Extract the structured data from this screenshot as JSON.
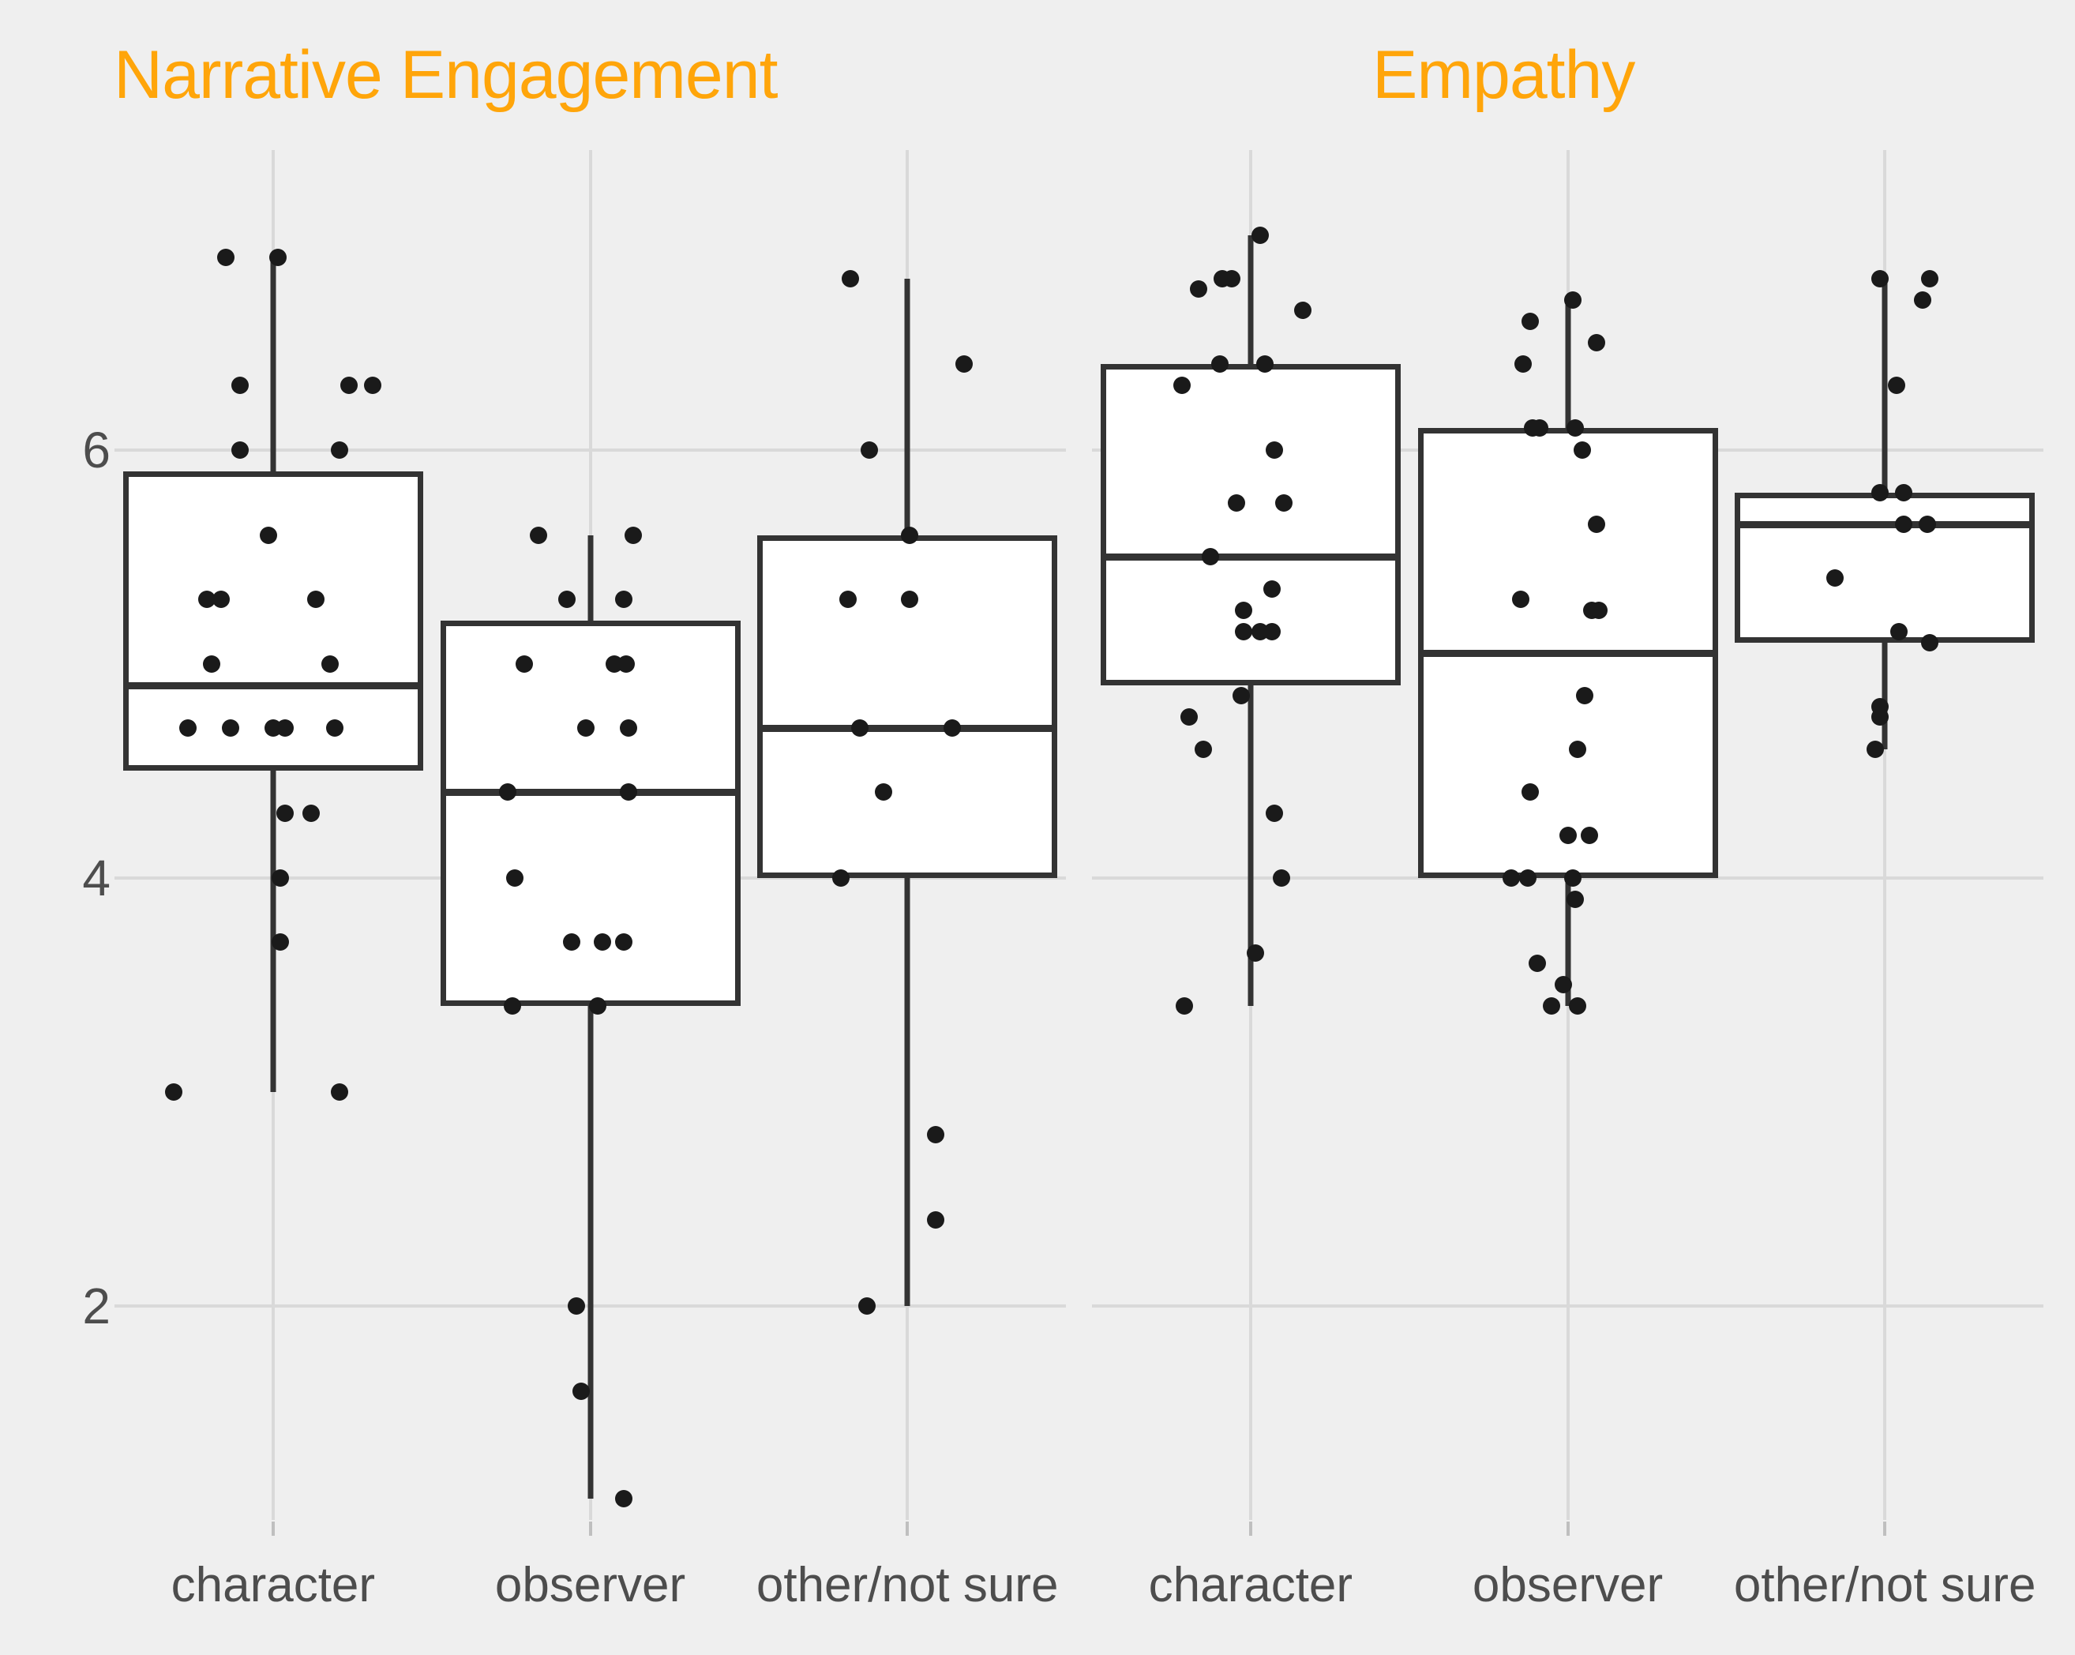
{
  "chart_data": {
    "type": "box",
    "title": "",
    "xlabel": "",
    "ylabel": "",
    "ylim": [
      1.0,
      7.4
    ],
    "yticks": [
      2,
      4,
      6
    ],
    "ytick_labels": [
      "2",
      "4",
      "6"
    ],
    "grid": true,
    "legend": "none",
    "accent_color": "#FFA50A",
    "point_color": "#1A1A1A",
    "box_fill": "#FFFFFF",
    "box_stroke": "#333333",
    "background": "#EFEFEF",
    "grid_color": "#D9D9D9",
    "categories": [
      "character",
      "observer",
      "other/not sure"
    ],
    "panels": [
      {
        "title": "Narrative Engagement",
        "groups": [
          {
            "label": "character",
            "box": {
              "lower_whisker": 3.0,
              "q1": 4.5,
              "median": 4.9,
              "q3": 5.9,
              "upper_whisker": 6.9
            },
            "points": [
              {
                "value": 6.9,
                "jitter": -0.2
              },
              {
                "value": 6.9,
                "jitter": 0.02
              },
              {
                "value": 6.3,
                "jitter": -0.14
              },
              {
                "value": 6.3,
                "jitter": 0.32
              },
              {
                "value": 6.3,
                "jitter": 0.42
              },
              {
                "value": 6.0,
                "jitter": -0.14
              },
              {
                "value": 6.0,
                "jitter": 0.28
              },
              {
                "value": 5.6,
                "jitter": -0.02
              },
              {
                "value": 5.3,
                "jitter": -0.28
              },
              {
                "value": 5.3,
                "jitter": -0.22
              },
              {
                "value": 5.3,
                "jitter": 0.18
              },
              {
                "value": 5.0,
                "jitter": -0.26
              },
              {
                "value": 5.0,
                "jitter": 0.24
              },
              {
                "value": 4.7,
                "jitter": -0.36
              },
              {
                "value": 4.7,
                "jitter": -0.18
              },
              {
                "value": 4.7,
                "jitter": 0.0
              },
              {
                "value": 4.7,
                "jitter": 0.05
              },
              {
                "value": 4.7,
                "jitter": 0.26
              },
              {
                "value": 4.3,
                "jitter": 0.05
              },
              {
                "value": 4.3,
                "jitter": 0.16
              },
              {
                "value": 4.0,
                "jitter": 0.03
              },
              {
                "value": 3.7,
                "jitter": 0.03
              },
              {
                "value": 3.0,
                "jitter": -0.42
              },
              {
                "value": 3.0,
                "jitter": 0.28
              }
            ]
          },
          {
            "label": "observer",
            "box": {
              "lower_whisker": 1.1,
              "q1": 3.4,
              "median": 4.4,
              "q3": 5.2,
              "upper_whisker": 5.6
            },
            "points": [
              {
                "value": 5.6,
                "jitter": -0.22
              },
              {
                "value": 5.6,
                "jitter": 0.18
              },
              {
                "value": 5.3,
                "jitter": -0.1
              },
              {
                "value": 5.3,
                "jitter": 0.14
              },
              {
                "value": 5.0,
                "jitter": -0.28
              },
              {
                "value": 5.0,
                "jitter": 0.1
              },
              {
                "value": 5.0,
                "jitter": 0.15
              },
              {
                "value": 4.7,
                "jitter": -0.02
              },
              {
                "value": 4.7,
                "jitter": 0.16
              },
              {
                "value": 4.4,
                "jitter": -0.35
              },
              {
                "value": 4.4,
                "jitter": 0.16
              },
              {
                "value": 4.0,
                "jitter": -0.32
              },
              {
                "value": 3.7,
                "jitter": -0.08
              },
              {
                "value": 3.7,
                "jitter": 0.05
              },
              {
                "value": 3.7,
                "jitter": 0.14
              },
              {
                "value": 3.4,
                "jitter": -0.33
              },
              {
                "value": 3.4,
                "jitter": 0.03
              },
              {
                "value": 2.0,
                "jitter": -0.06
              },
              {
                "value": 1.6,
                "jitter": -0.04
              },
              {
                "value": 1.1,
                "jitter": 0.14
              }
            ]
          },
          {
            "label": "other/not sure",
            "box": {
              "lower_whisker": 2.0,
              "q1": 4.0,
              "median": 4.7,
              "q3": 5.6,
              "upper_whisker": 6.8
            },
            "points": [
              {
                "value": 6.8,
                "jitter": -0.24
              },
              {
                "value": 6.4,
                "jitter": 0.24
              },
              {
                "value": 6.0,
                "jitter": -0.16
              },
              {
                "value": 5.6,
                "jitter": 0.01
              },
              {
                "value": 5.3,
                "jitter": -0.25
              },
              {
                "value": 5.3,
                "jitter": 0.01
              },
              {
                "value": 4.7,
                "jitter": -0.2
              },
              {
                "value": 4.7,
                "jitter": 0.19
              },
              {
                "value": 4.4,
                "jitter": -0.1
              },
              {
                "value": 4.0,
                "jitter": -0.28
              },
              {
                "value": 2.8,
                "jitter": 0.12
              },
              {
                "value": 2.4,
                "jitter": 0.12
              },
              {
                "value": 2.0,
                "jitter": -0.17
              }
            ]
          }
        ]
      },
      {
        "title": "Empathy",
        "groups": [
          {
            "label": "character",
            "box": {
              "lower_whisker": 3.4,
              "q1": 4.9,
              "median": 5.5,
              "q3": 6.4,
              "upper_whisker": 7.0
            },
            "points": [
              {
                "value": 7.0,
                "jitter": 0.04
              },
              {
                "value": 6.8,
                "jitter": -0.12
              },
              {
                "value": 6.8,
                "jitter": -0.08
              },
              {
                "value": 6.75,
                "jitter": -0.22
              },
              {
                "value": 6.65,
                "jitter": 0.22
              },
              {
                "value": 6.4,
                "jitter": -0.13
              },
              {
                "value": 6.4,
                "jitter": 0.06
              },
              {
                "value": 6.3,
                "jitter": -0.29
              },
              {
                "value": 6.0,
                "jitter": 0.1
              },
              {
                "value": 5.75,
                "jitter": -0.06
              },
              {
                "value": 5.75,
                "jitter": 0.14
              },
              {
                "value": 5.5,
                "jitter": -0.17
              },
              {
                "value": 5.35,
                "jitter": 0.09
              },
              {
                "value": 5.25,
                "jitter": -0.03
              },
              {
                "value": 5.15,
                "jitter": -0.03
              },
              {
                "value": 5.15,
                "jitter": 0.04
              },
              {
                "value": 5.15,
                "jitter": 0.09
              },
              {
                "value": 4.85,
                "jitter": -0.04
              },
              {
                "value": 4.75,
                "jitter": -0.26
              },
              {
                "value": 4.6,
                "jitter": -0.2
              },
              {
                "value": 4.3,
                "jitter": 0.1
              },
              {
                "value": 4.0,
                "jitter": 0.13
              },
              {
                "value": 3.65,
                "jitter": 0.02
              },
              {
                "value": 3.4,
                "jitter": -0.28
              }
            ]
          },
          {
            "label": "observer",
            "box": {
              "lower_whisker": 3.4,
              "q1": 4.0,
              "median": 5.05,
              "q3": 6.1,
              "upper_whisker": 6.7
            },
            "points": [
              {
                "value": 6.7,
                "jitter": 0.02
              },
              {
                "value": 6.6,
                "jitter": -0.16
              },
              {
                "value": 6.5,
                "jitter": 0.12
              },
              {
                "value": 6.4,
                "jitter": -0.19
              },
              {
                "value": 6.1,
                "jitter": -0.15
              },
              {
                "value": 6.1,
                "jitter": -0.12
              },
              {
                "value": 6.1,
                "jitter": 0.03
              },
              {
                "value": 6.0,
                "jitter": 0.06
              },
              {
                "value": 5.65,
                "jitter": 0.12
              },
              {
                "value": 5.3,
                "jitter": -0.2
              },
              {
                "value": 5.25,
                "jitter": 0.1
              },
              {
                "value": 5.25,
                "jitter": 0.13
              },
              {
                "value": 4.85,
                "jitter": 0.07
              },
              {
                "value": 4.6,
                "jitter": 0.04
              },
              {
                "value": 4.4,
                "jitter": -0.16
              },
              {
                "value": 4.2,
                "jitter": 0.0
              },
              {
                "value": 4.2,
                "jitter": 0.09
              },
              {
                "value": 4.0,
                "jitter": -0.24
              },
              {
                "value": 4.0,
                "jitter": -0.17
              },
              {
                "value": 4.0,
                "jitter": 0.02
              },
              {
                "value": 3.9,
                "jitter": 0.03
              },
              {
                "value": 3.6,
                "jitter": -0.13
              },
              {
                "value": 3.5,
                "jitter": -0.02
              },
              {
                "value": 3.4,
                "jitter": -0.07
              },
              {
                "value": 3.4,
                "jitter": 0.04
              }
            ]
          },
          {
            "label": "other/not sure",
            "box": {
              "lower_whisker": 4.6,
              "q1": 5.1,
              "median": 5.65,
              "q3": 5.8,
              "upper_whisker": 6.8
            },
            "points": [
              {
                "value": 6.8,
                "jitter": -0.02
              },
              {
                "value": 6.8,
                "jitter": 0.19
              },
              {
                "value": 6.7,
                "jitter": 0.16
              },
              {
                "value": 6.3,
                "jitter": 0.05
              },
              {
                "value": 5.8,
                "jitter": -0.02
              },
              {
                "value": 5.8,
                "jitter": 0.08
              },
              {
                "value": 5.65,
                "jitter": 0.08
              },
              {
                "value": 5.65,
                "jitter": 0.18
              },
              {
                "value": 5.4,
                "jitter": -0.21
              },
              {
                "value": 5.15,
                "jitter": 0.06
              },
              {
                "value": 5.1,
                "jitter": 0.19
              },
              {
                "value": 4.8,
                "jitter": -0.02
              },
              {
                "value": 4.75,
                "jitter": -0.02
              },
              {
                "value": 4.6,
                "jitter": -0.04
              }
            ]
          }
        ]
      }
    ]
  }
}
